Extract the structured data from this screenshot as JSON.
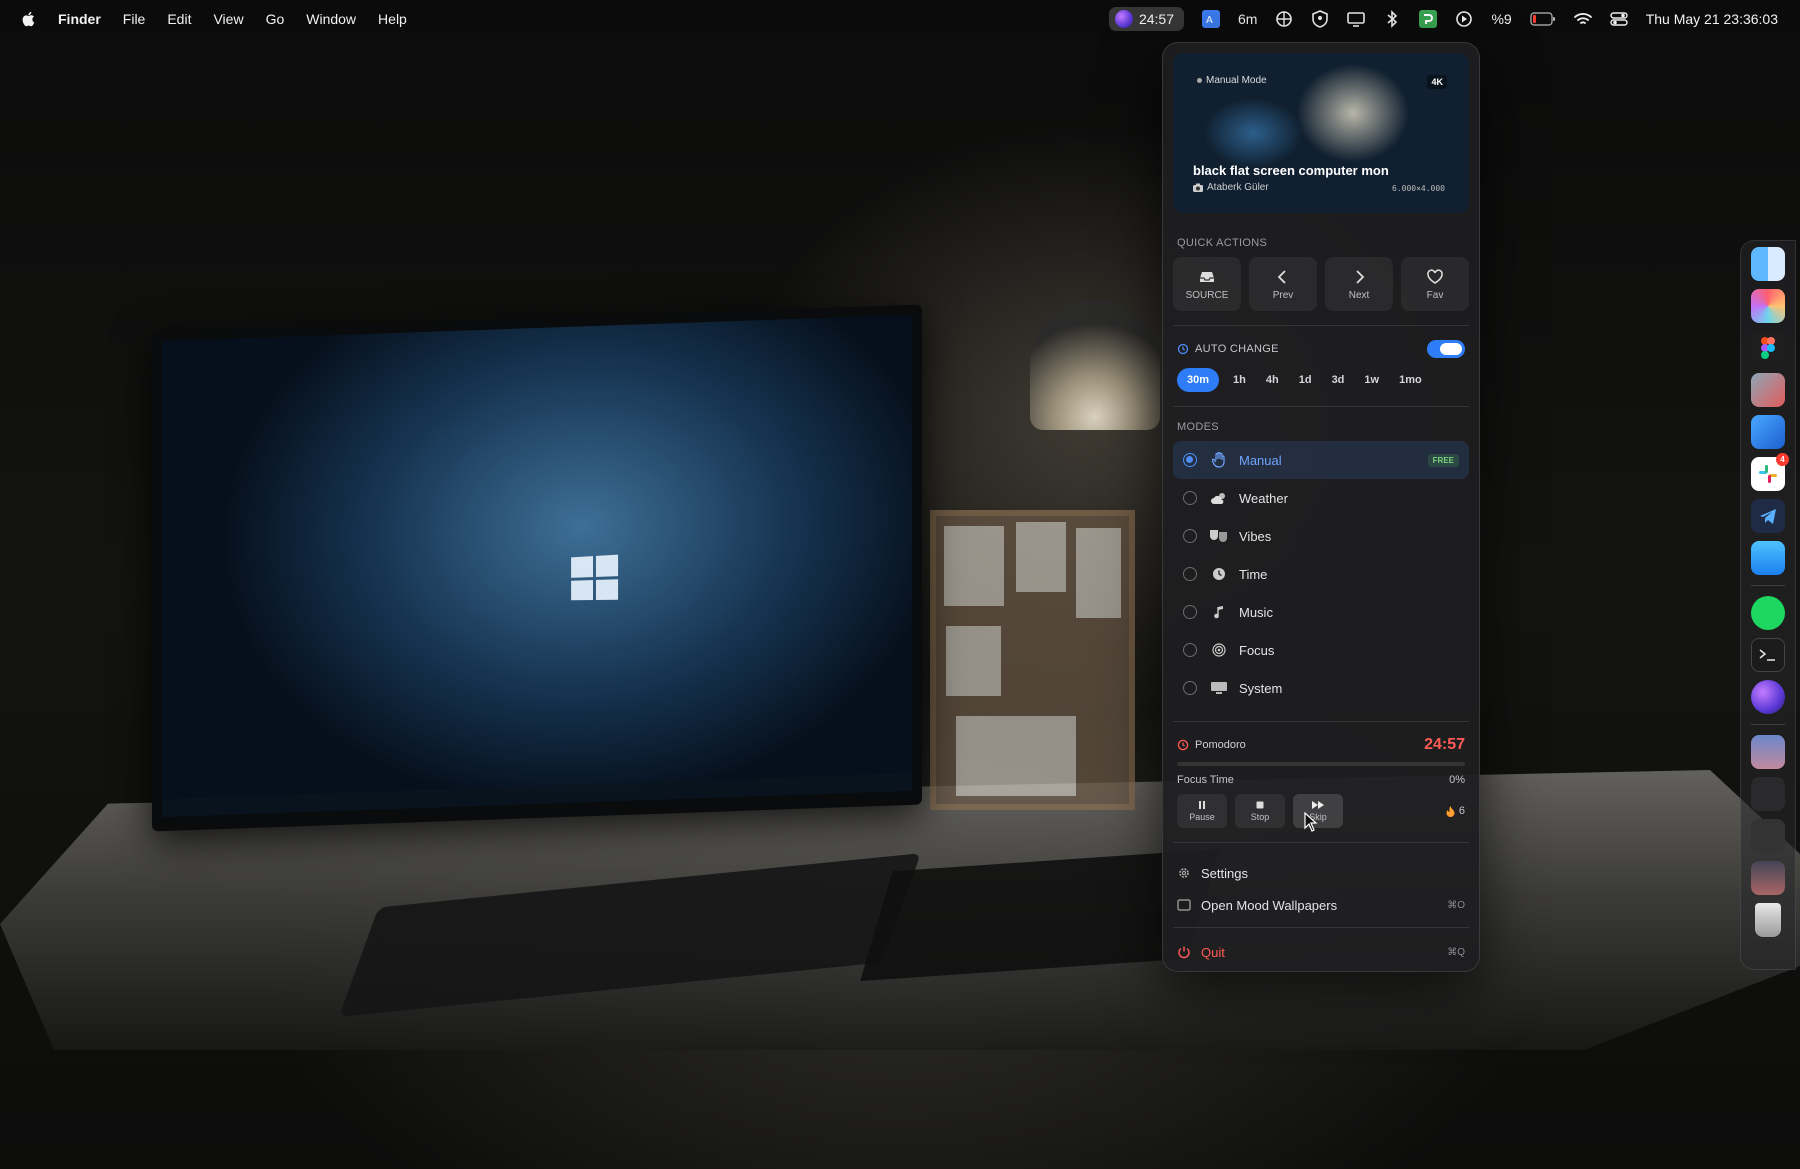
{
  "menubar": {
    "app_name": "Finder",
    "items": [
      "File",
      "Edit",
      "View",
      "Go",
      "Window",
      "Help"
    ],
    "status": {
      "timer": "24:57",
      "duration": "6m",
      "battery": "%9",
      "datetime": "Thu May 21  23:36:03"
    }
  },
  "panel": {
    "preview": {
      "mode": "Manual Mode",
      "resolution_badge": "4K",
      "title": "black flat screen computer mon",
      "author": "Ataberk Güler",
      "dimensions": "6.000×4.000"
    },
    "quick_actions": {
      "label": "QUICK ACTIONS",
      "buttons": [
        {
          "label": "SOURCE",
          "icon": "tray-icon"
        },
        {
          "label": "Prev",
          "icon": "chevron-left-icon"
        },
        {
          "label": "Next",
          "icon": "chevron-right-icon"
        },
        {
          "label": "Fav",
          "icon": "heart-icon"
        }
      ]
    },
    "auto_change": {
      "label": "AUTO CHANGE",
      "enabled": true,
      "intervals": [
        "30m",
        "1h",
        "4h",
        "1d",
        "3d",
        "1w",
        "1mo"
      ],
      "selected": "30m"
    },
    "modes": {
      "label": "MODES",
      "items": [
        {
          "label": "Manual",
          "icon": "hand-icon",
          "selected": true,
          "badge": "FREE"
        },
        {
          "label": "Weather",
          "icon": "cloud-sun-icon"
        },
        {
          "label": "Vibes",
          "icon": "theater-masks-icon"
        },
        {
          "label": "Time",
          "icon": "clock-icon"
        },
        {
          "label": "Music",
          "icon": "music-note-icon"
        },
        {
          "label": "Focus",
          "icon": "target-icon"
        },
        {
          "label": "System",
          "icon": "monitor-icon"
        }
      ]
    },
    "pomodoro": {
      "title": "Pomodoro",
      "time": "24:57",
      "focus_label": "Focus Time",
      "progress_text": "0%",
      "progress": 0,
      "controls": [
        "Pause",
        "Stop",
        "Skip"
      ],
      "streak": "6"
    },
    "menu": {
      "settings": "Settings",
      "open": "Open Mood Wallpapers",
      "open_shortcut": "⌘O",
      "quit": "Quit",
      "quit_shortcut": "⌘Q"
    }
  },
  "colors": {
    "accent": "#2e7cf6",
    "pomodoro": "#ff5b55",
    "free_badge": "#7ad17e"
  }
}
